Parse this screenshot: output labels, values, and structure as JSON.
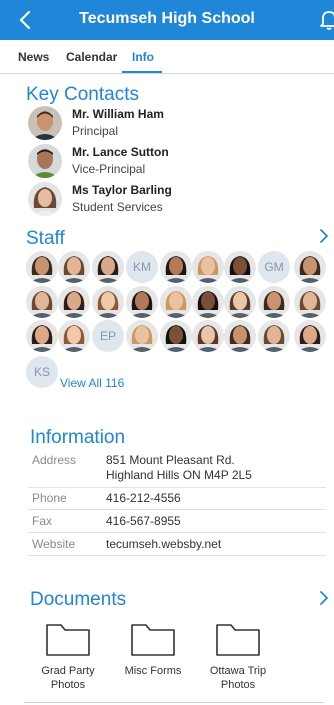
{
  "header": {
    "title": "Tecumseh High School",
    "back_icon": "chevron-left-icon",
    "bell_icon": "bell-icon",
    "background": "#1f86d8"
  },
  "tabs": [
    {
      "label": "News",
      "active": false
    },
    {
      "label": "Calendar",
      "active": false
    },
    {
      "label": "Info",
      "active": true
    }
  ],
  "key_contacts": {
    "title": "Key Contacts",
    "items": [
      {
        "name": "Mr. William Ham",
        "role": "Principal"
      },
      {
        "name": "Mr. Lance Sutton",
        "role": "Vice-Principal"
      },
      {
        "name": "Ms Taylor Barling",
        "role": "Student Services"
      }
    ]
  },
  "staff": {
    "title": "Staff",
    "initials": [
      "KM",
      "GM",
      "EP",
      "KS"
    ],
    "view_all": "View All 116"
  },
  "information": {
    "title": "Information",
    "address_label": "Address",
    "address_line1": "851 Mount Pleasant Rd.",
    "address_line2": "Highland Hills ON M4P 2L5",
    "phone_label": "Phone",
    "phone": "416-212-4556",
    "fax_label": "Fax",
    "fax": "416-567-8955",
    "website_label": "Website",
    "website": "tecumseh.websby.net"
  },
  "documents": {
    "title": "Documents",
    "items": [
      {
        "line1": "Grad Party",
        "line2": "Photos"
      },
      {
        "line1": "Misc Forms",
        "line2": ""
      },
      {
        "line1": "Ottawa Trip",
        "line2": "Photos"
      }
    ]
  },
  "colors": {
    "accent": "#1f86d8",
    "initials_bg": "#dfe6ee",
    "initials_text": "#7f99b3"
  }
}
